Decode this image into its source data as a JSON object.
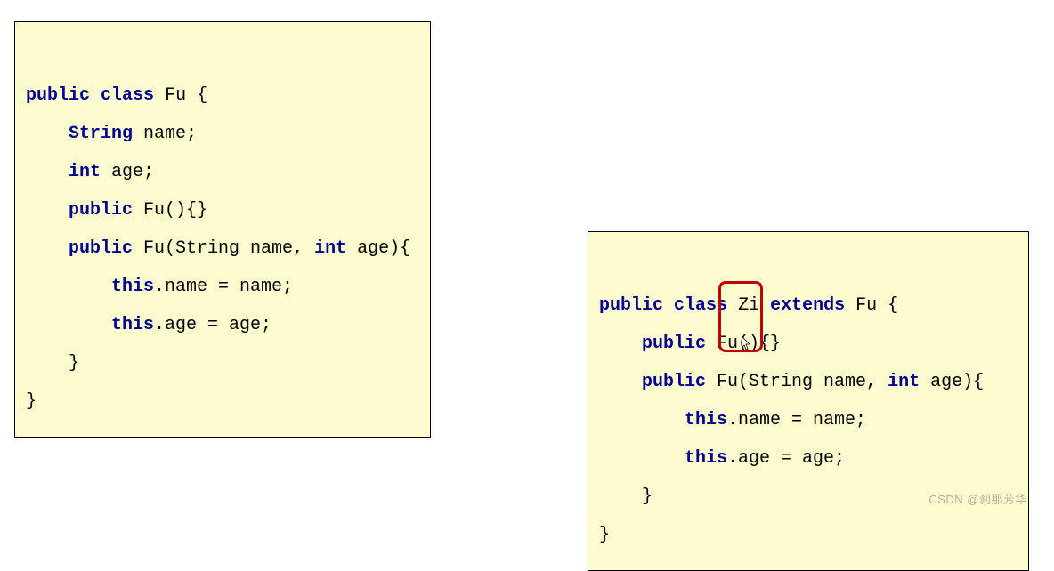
{
  "left": {
    "l1a": "public",
    "l1b": "class",
    "l2a": "String ",
    "l3a": "int ",
    "l4a": "public",
    "l5a": "public",
    "l5c": "int",
    "l6a": "this",
    "l7a": "this",
    "class_name": "Fu",
    "open": " {",
    "name_decl": "name;",
    "age_decl": "age;",
    "ctor0": " Fu(){}",
    "ctor1a": " Fu(String name, ",
    "ctor1b": " age){",
    "stmt_name": ".name = name;",
    "stmt_age": ".age = age;",
    "close_brace": "}",
    "indent1": "    ",
    "indent2": "        "
  },
  "right": {
    "l1a": "public",
    "l1b": "class",
    "l1c": "extends",
    "l2a": "public",
    "l3a": "public",
    "l3c": "int",
    "l4a": "this",
    "l5a": "this",
    "class_name": "Zi",
    "parent_name": "Fu",
    "open": " {",
    "ctor0": " Fu(){}",
    "ctor1a": " Fu(String name, ",
    "ctor1b": " age){",
    "stmt_name": ".name = name;",
    "stmt_age": ".age = age;",
    "close_brace": "}",
    "indent1": "    ",
    "indent2": "        "
  },
  "watermark": "CSDN @刹那芳华"
}
